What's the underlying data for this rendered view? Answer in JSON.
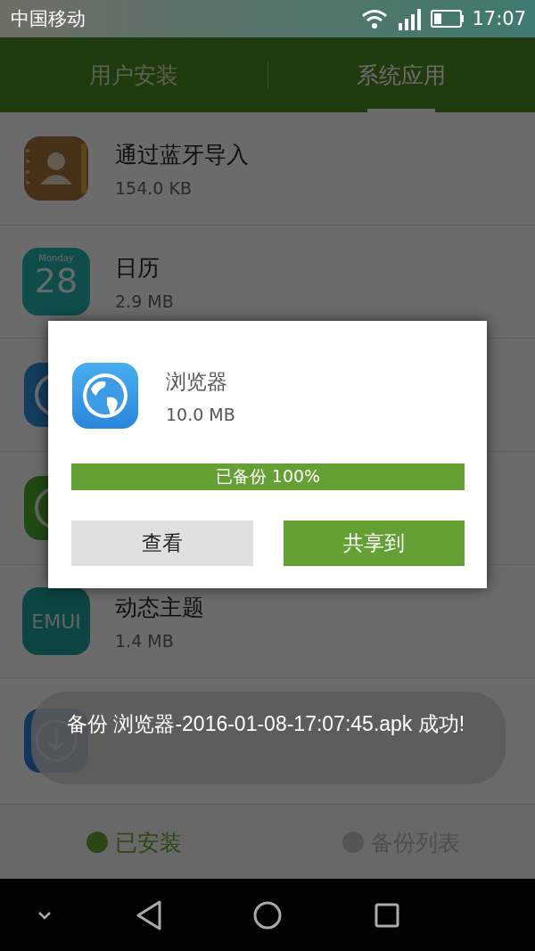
{
  "status_bar": {
    "carrier": "中国移动",
    "time": "17:07"
  },
  "tabs": [
    {
      "label": "用户安装",
      "selected": false
    },
    {
      "label": "系统应用",
      "selected": true
    }
  ],
  "apps": [
    {
      "kind": "contacts",
      "name": "通过蓝牙导入",
      "size": "154.0 KB"
    },
    {
      "kind": "calendar",
      "name": "日历",
      "size": "2.9 MB",
      "icon_text": [
        "Monday",
        "28"
      ]
    },
    {
      "kind": "globe"
    },
    {
      "kind": "chat"
    },
    {
      "kind": "theme",
      "name": "动态主题",
      "size": "1.4 MB",
      "icon_text": [
        "EMUI"
      ]
    },
    {
      "kind": "download"
    }
  ],
  "dialog": {
    "app_name": "浏览器",
    "app_size": "10.0 MB",
    "progress": {
      "level": 1.0,
      "label": "已备份 100%"
    },
    "buttons": [
      {
        "label": "查看",
        "kind": "secondary"
      },
      {
        "label": "共享到",
        "kind": "primary"
      }
    ]
  },
  "toast": "备份 浏览器-2016-01-08-17:07:45.apk 成功!",
  "bottom_tabs": [
    {
      "label": "已安装",
      "selected": true
    },
    {
      "label": "备份列表",
      "selected": false
    }
  ]
}
